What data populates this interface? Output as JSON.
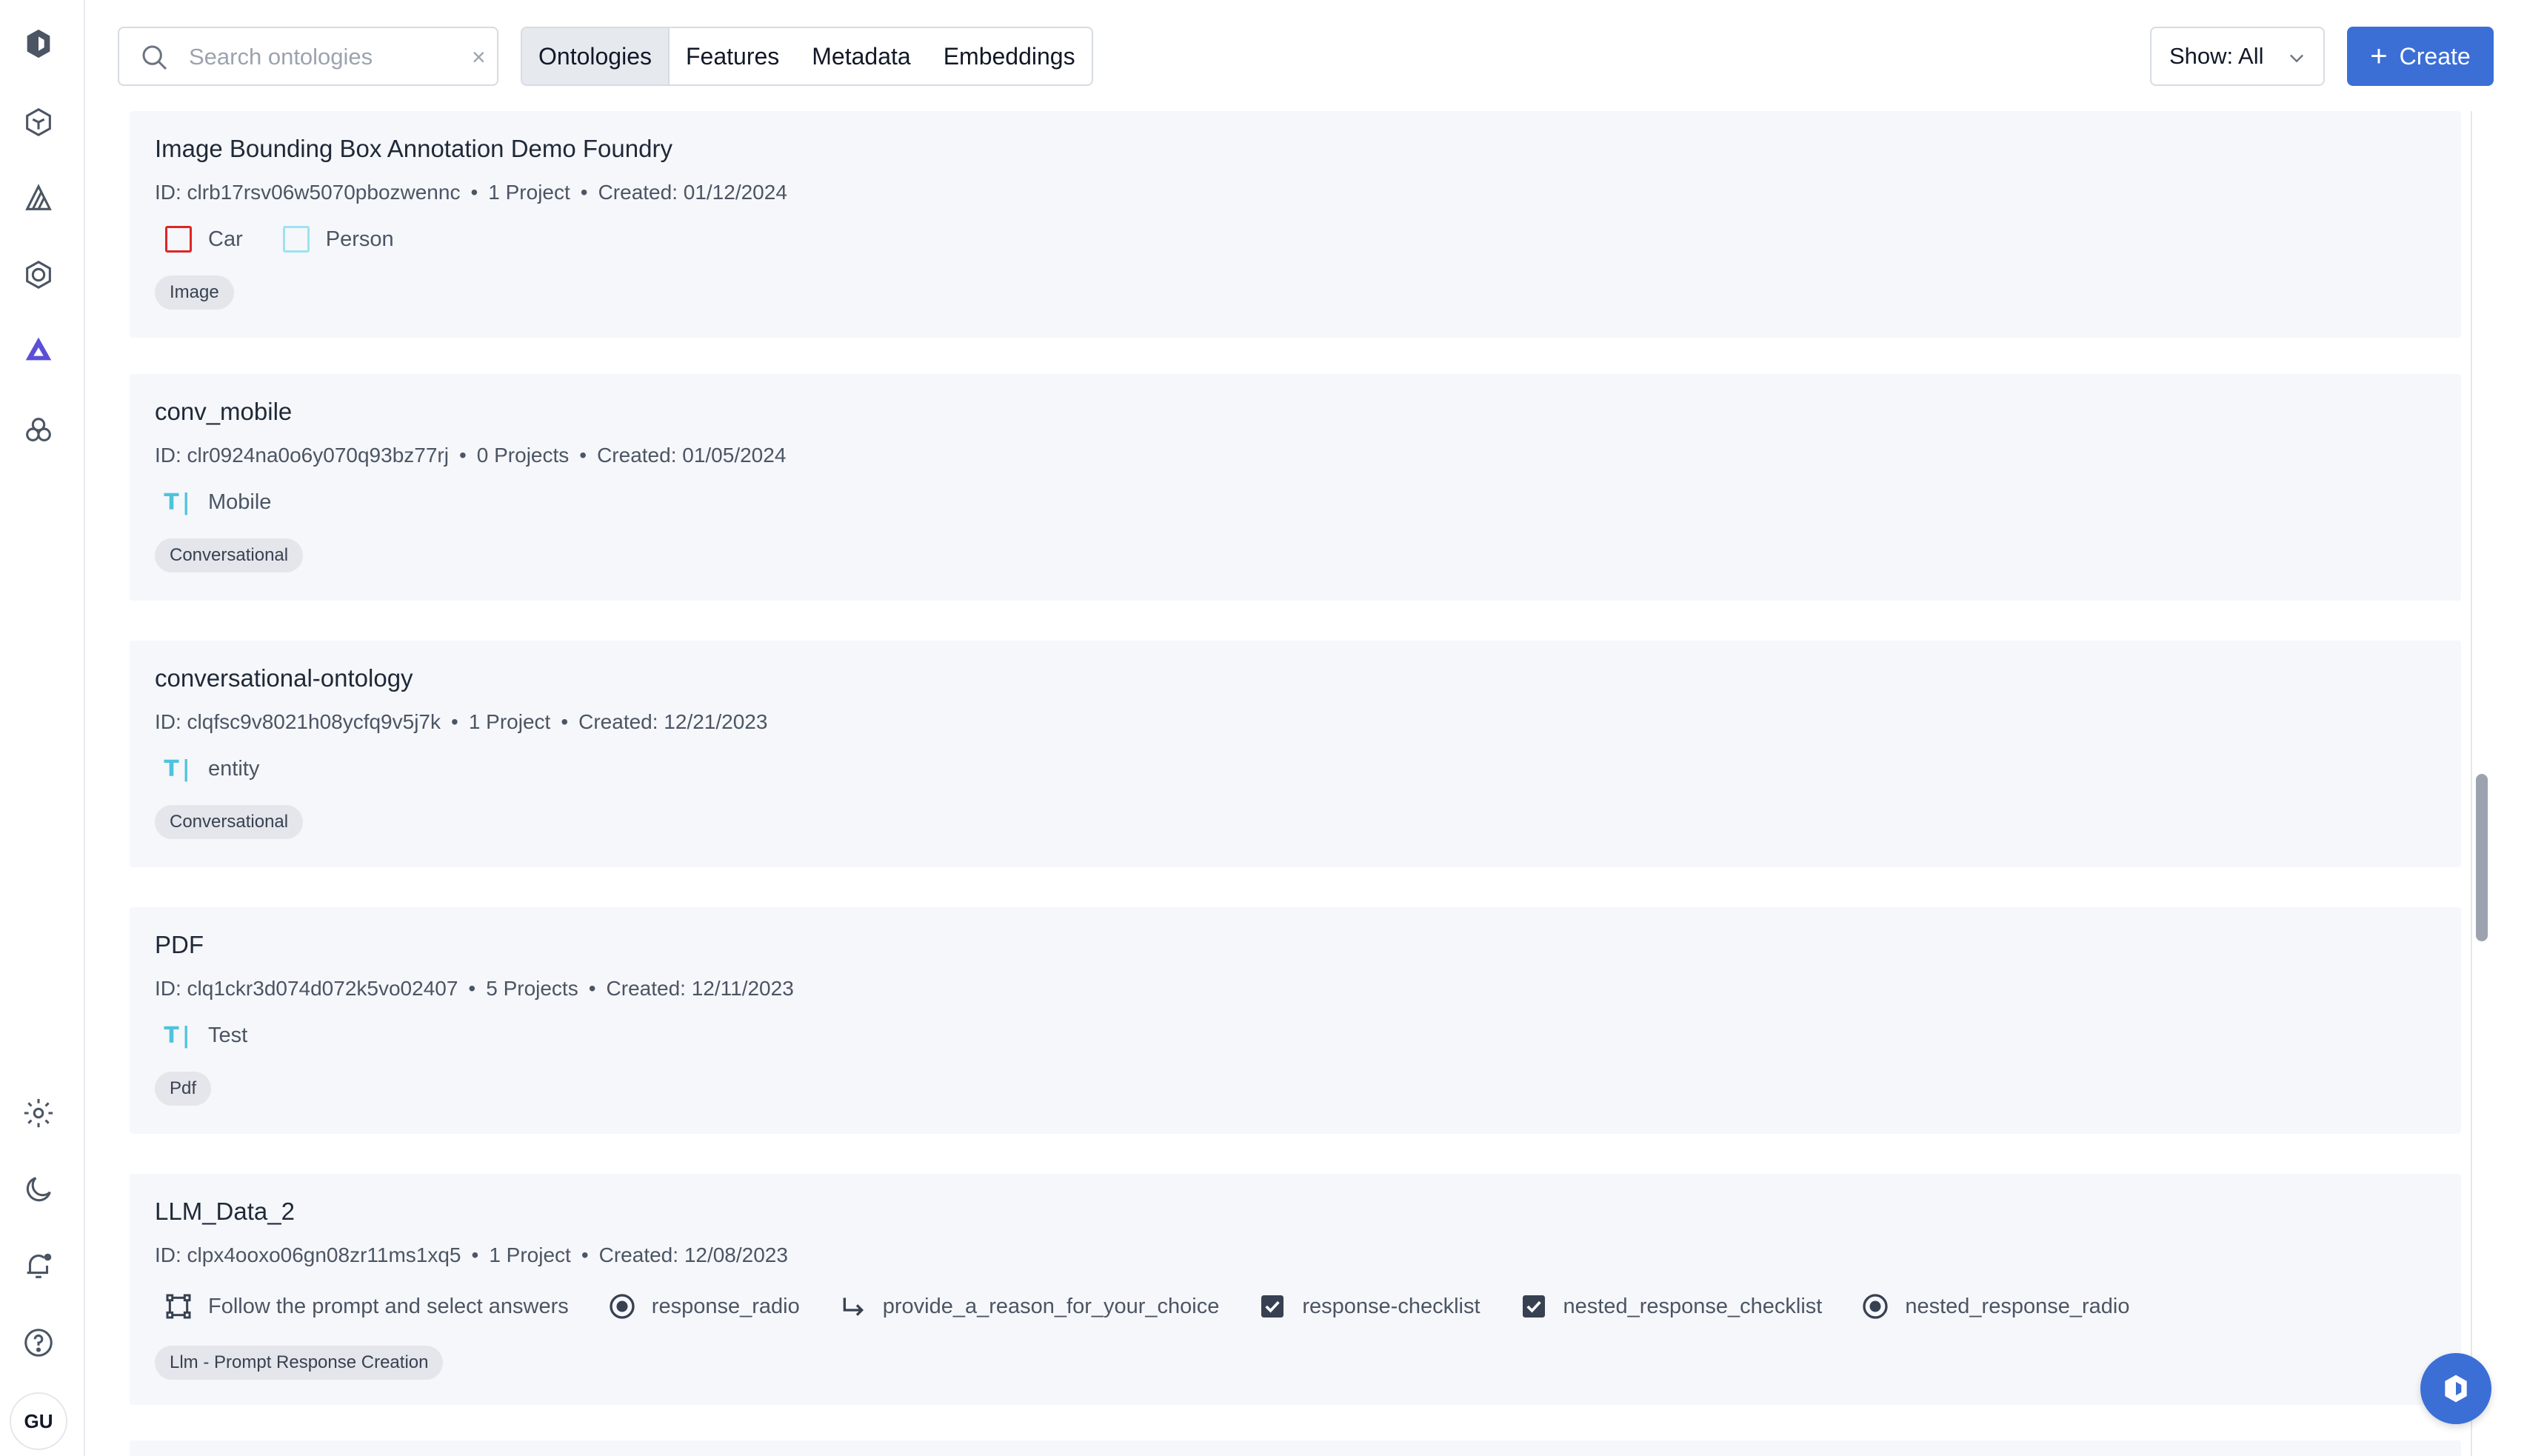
{
  "search": {
    "placeholder": "Search ontologies",
    "clear": "×"
  },
  "tabs": [
    {
      "label": "Ontologies",
      "active": true
    },
    {
      "label": "Features",
      "active": false
    },
    {
      "label": "Metadata",
      "active": false
    },
    {
      "label": "Embeddings",
      "active": false
    }
  ],
  "show_filter": {
    "label": "Show: All"
  },
  "create_button": {
    "label": "Create"
  },
  "user": {
    "initials": "GU"
  },
  "colors": {
    "accent": "#3b6fd6",
    "card_bg": "#f6f7fb",
    "car": "#dc2626",
    "person": "#9be3f0",
    "text_feature": "#4fc3dc"
  },
  "ontologies": [
    {
      "title": "Image Bounding Box Annotation Demo Foundry",
      "id": "ID: clrb17rsv06w5070pbozwennc",
      "projects": "1 Project",
      "created": "Created: 01/12/2024",
      "features": [
        {
          "icon": "bounding-box-red-icon",
          "label": "Car"
        },
        {
          "icon": "bounding-box-cyan-icon",
          "label": "Person"
        }
      ],
      "tag": "Image"
    },
    {
      "title": "conv_mobile",
      "id": "ID: clr0924na0o6y070q93bz77rj",
      "projects": "0 Projects",
      "created": "Created: 01/05/2024",
      "features": [
        {
          "icon": "text-icon",
          "label": "Mobile"
        }
      ],
      "tag": "Conversational"
    },
    {
      "title": "conversational-ontology",
      "id": "ID: clqfsc9v8021h08ycfq9v5j7k",
      "projects": "1 Project",
      "created": "Created: 12/21/2023",
      "features": [
        {
          "icon": "text-icon",
          "label": "entity"
        }
      ],
      "tag": "Conversational"
    },
    {
      "title": "PDF",
      "id": "ID: clq1ckr3d074d072k5vo02407",
      "projects": "5 Projects",
      "created": "Created: 12/11/2023",
      "features": [
        {
          "icon": "text-icon",
          "label": "Test"
        }
      ],
      "tag": "Pdf"
    },
    {
      "title": "LLM_Data_2",
      "id": "ID: clpx4ooxo06gn08zr11ms1xq5",
      "projects": "1 Project",
      "created": "Created: 12/08/2023",
      "features": [
        {
          "icon": "relation-box-icon",
          "label": "Follow the prompt and select answers"
        },
        {
          "icon": "radio-icon",
          "label": "response_radio"
        },
        {
          "icon": "nested-arrow-icon",
          "label": "provide_a_reason_for_your_choice"
        },
        {
          "icon": "checkbox-icon",
          "label": "response-checklist"
        },
        {
          "icon": "checkbox-icon",
          "label": "nested_response_checklist"
        },
        {
          "icon": "radio-icon",
          "label": "nested_response_radio"
        }
      ],
      "tag": "Llm - Prompt Response Creation"
    }
  ]
}
